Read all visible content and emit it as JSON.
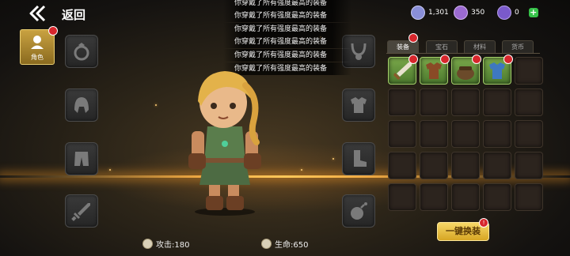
{
  "header": {
    "back_label": "返回"
  },
  "resources": [
    {
      "name": "diamond",
      "icon": "diamond-icon",
      "value": "1,301",
      "color": "#8a8fd8"
    },
    {
      "name": "token",
      "icon": "token-icon",
      "value": "350",
      "color": "#9b6ad0"
    },
    {
      "name": "energy",
      "icon": "energy-icon",
      "value": "0",
      "color": "#7a5acb"
    }
  ],
  "sidebar": {
    "role_label": "角色"
  },
  "messages": [
    "你穿戴了所有强度最高的装备",
    "你穿戴了所有强度最高的装备",
    "你穿戴了所有强度最高的装备",
    "你穿戴了所有强度最高的装备",
    "你穿戴了所有强度最高的装备",
    "你穿戴了所有强度最高的装备"
  ],
  "inventory": {
    "tabs": [
      {
        "label": "装备",
        "active": true
      },
      {
        "label": "宝石",
        "active": false
      },
      {
        "label": "材料",
        "active": false
      },
      {
        "label": "货币",
        "active": false
      }
    ],
    "items": [
      "sword-icon",
      "leather-armor-icon",
      "bag-icon",
      "blue-armor-icon"
    ]
  },
  "equip_button": {
    "label": "一键换装"
  },
  "stats": {
    "attack": "攻击:180",
    "health": "生命:650"
  },
  "colors": {
    "accent_gold": "#d7a623",
    "badge_red": "#d7262c",
    "item_green": "#5e8c38"
  }
}
